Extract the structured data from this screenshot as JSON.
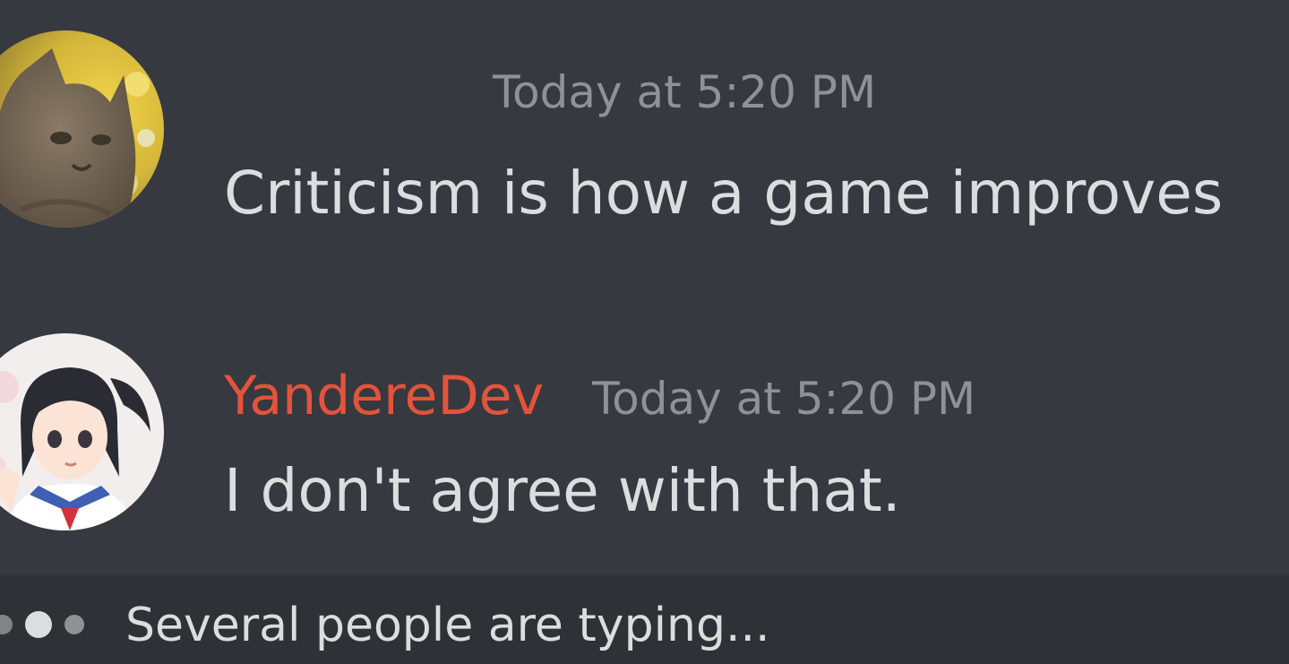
{
  "messages": [
    {
      "avatar_icon": "cat-avatar-icon",
      "timestamp": "Today at 5:20 PM",
      "content": "Criticism is how a game improves"
    },
    {
      "avatar_icon": "anime-girl-avatar-icon",
      "username": "YandereDev",
      "username_color": "#e4533c",
      "timestamp": "Today at 5:20 PM",
      "content": "I don't agree with that."
    }
  ],
  "typing": {
    "icon": "typing-dots-icon",
    "text": "Several people are typing..."
  },
  "colors": {
    "background": "#36393f",
    "typing_bar": "#2f3136",
    "message_text": "#dcddde",
    "timestamp_text": "#8e9297"
  }
}
